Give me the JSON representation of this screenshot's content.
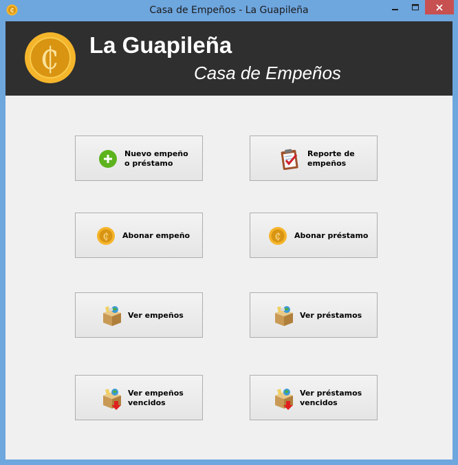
{
  "window": {
    "title": "Casa de Empeños - La Guapileña"
  },
  "header": {
    "brand": "La Guapileña",
    "tagline": "Casa de Empeños",
    "logo_symbol": "₵"
  },
  "colors": {
    "header_bg": "#2f2f2f",
    "coin_gold": "#f5b52b",
    "coin_dark": "#c98a10",
    "plus_green": "#5cb31e",
    "arrow_red": "#e02020"
  },
  "buttons": [
    {
      "label": "Nuevo empeño\no préstamo",
      "icon": "plus-circle-icon"
    },
    {
      "label": "Reporte de\nempeños",
      "icon": "clipboard-check-icon"
    },
    {
      "label": "Abonar empeño",
      "icon": "coin-icon"
    },
    {
      "label": "Abonar préstamo",
      "icon": "coin-icon"
    },
    {
      "label": "Ver empeños",
      "icon": "box-icon"
    },
    {
      "label": "Ver préstamos",
      "icon": "box-icon"
    },
    {
      "label": "Ver empeños\nvencidos",
      "icon": "box-expired-icon"
    },
    {
      "label": "Ver préstamos\nvencidos",
      "icon": "box-expired-icon"
    }
  ]
}
